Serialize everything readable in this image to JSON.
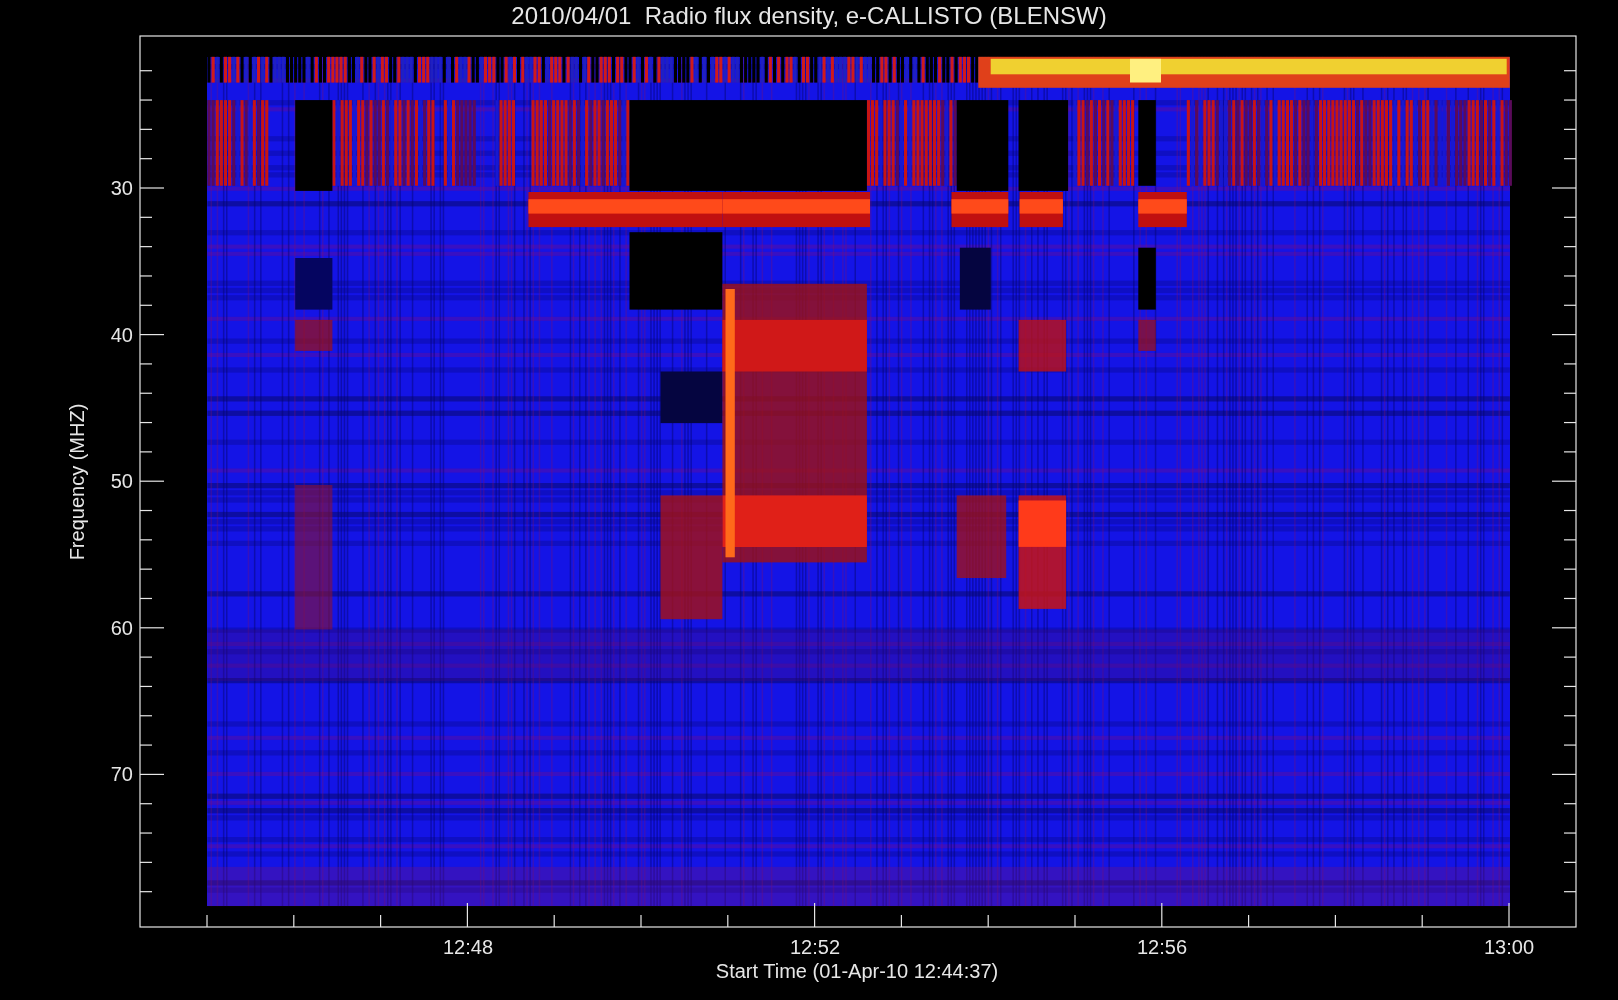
{
  "title": "2010/04/01  Radio flux density, e-CALLISTO (BLENSW)",
  "y_axis": {
    "label": "Frequency (MHZ)",
    "ticks": [
      "30",
      "40",
      "50",
      "60",
      "70"
    ]
  },
  "x_axis": {
    "label": "Start Time (01-Apr-10 12:44:37)",
    "ticks": [
      "12:48",
      "12:52",
      "12:56",
      "13:00"
    ]
  }
}
